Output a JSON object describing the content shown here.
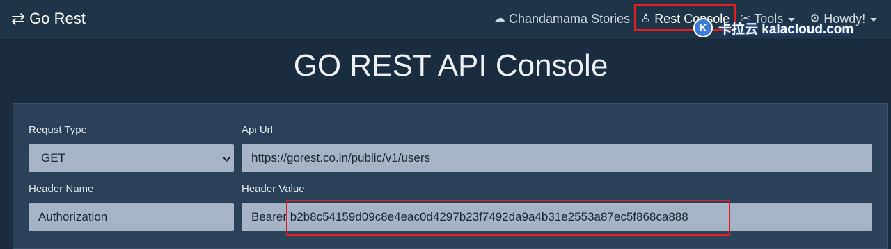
{
  "nav": {
    "brand": "Go Rest",
    "brand_icon": "exchange-arrows-icon",
    "links": [
      {
        "label": "Chandamama Stories",
        "icon": "moon-cloud-icon"
      },
      {
        "label": "Rest Console",
        "icon": "linux-penguin-icon",
        "active": true
      },
      {
        "label": "Tools",
        "icon": "tools-icon",
        "dropdown": true
      },
      {
        "label": "Howdy!",
        "icon": "user-gear-icon",
        "dropdown": true
      }
    ]
  },
  "watermark": {
    "text": "卡拉云 kalacloud.com"
  },
  "page": {
    "title": "GO REST API Console"
  },
  "form": {
    "request_type": {
      "label": "Requst Type",
      "value": "GET"
    },
    "api_url": {
      "label": "Api Url",
      "value": "https://gorest.co.in/public/v1/users"
    },
    "header_name": {
      "label": "Header Name",
      "value": "Authorization"
    },
    "header_value": {
      "label": "Header Value",
      "value": "Bearer b2b8c54159d09c8e4eac0d4297b23f7492da9a4b31e2553a87ec5f868ca888"
    }
  },
  "colors": {
    "highlight": "#e02020",
    "navbar": "#1f3447",
    "panel": "#2b4157",
    "input": "#a7b4c5"
  }
}
